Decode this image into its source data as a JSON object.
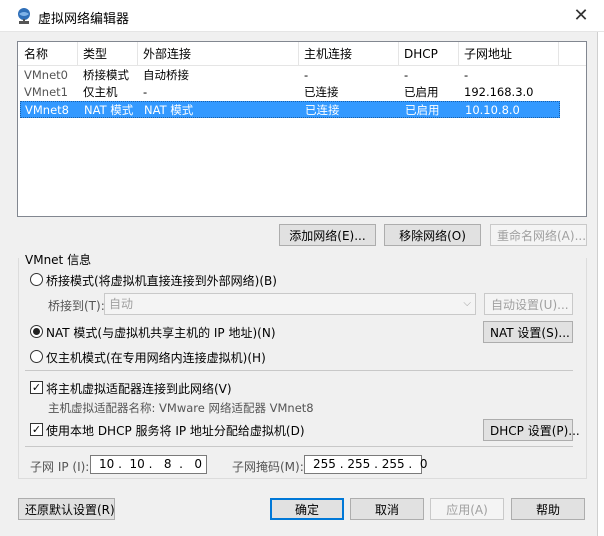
{
  "window": {
    "title": "虚拟网络编辑器",
    "close_glyph": "✕"
  },
  "table": {
    "columns": [
      "名称",
      "类型",
      "外部连接",
      "主机连接",
      "DHCP",
      "子网地址"
    ],
    "rows": [
      [
        "VMnet0",
        "桥接模式",
        "自动桥接",
        "-",
        "-",
        "-"
      ],
      [
        "VMnet1",
        "仅主机",
        "-",
        "已连接",
        "已启用",
        "192.168.3.0"
      ],
      [
        "VMnet8",
        "NAT 模式",
        "NAT 模式",
        "已连接",
        "已启用",
        "10.10.8.0"
      ]
    ],
    "selected_index": 2
  },
  "list_buttons": {
    "add": "添加网络(E)...",
    "remove": "移除网络(O)",
    "rename": "重命名网络(A)..."
  },
  "vmnet_info": {
    "group_title": "VMnet 信息",
    "bridge_mode": "桥接模式(将虚拟机直接连接到外部网络)(B)",
    "bridge_to_label": "桥接到(T):",
    "bridge_to_value": "自动",
    "auto_settings": "自动设置(U)...",
    "nat_mode": "NAT 模式(与虚拟机共享主机的 IP 地址)(N)",
    "nat_settings": "NAT 设置(S)...",
    "host_only": "仅主机模式(在专用网络内连接虚拟机)(H)",
    "selected_mode": "nat",
    "connect_adapter": "将主机虚拟适配器连接到此网络(V)",
    "connect_adapter_checked": true,
    "adapter_name": "主机虚拟适配器名称: VMware 网络适配器 VMnet8",
    "use_dhcp": "使用本地 DHCP 服务将 IP 地址分配给虚拟机(D)",
    "use_dhcp_checked": true,
    "dhcp_settings": "DHCP 设置(P)...",
    "subnet_ip_label": "子网 IP (I):",
    "subnet_ip": "10 .  10 .   8  .   0",
    "subnet_mask_label": "子网掩码(M):",
    "subnet_mask": "255 . 255 . 255 .  0"
  },
  "footer_buttons": {
    "restore": "还原默认设置(R)",
    "ok": "确定",
    "cancel": "取消",
    "apply": "应用(A)",
    "help": "帮助"
  },
  "check_glyph": "✓",
  "combo_arrow": "⌵"
}
